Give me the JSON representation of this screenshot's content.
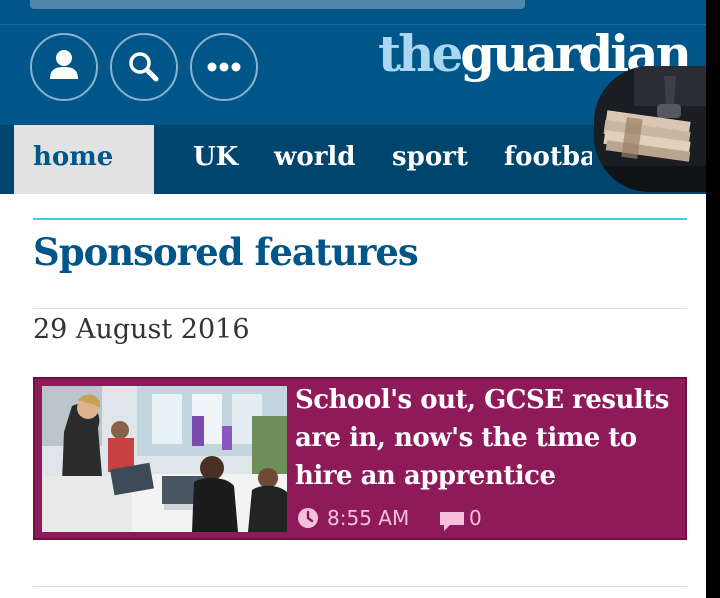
{
  "header": {
    "logo_the": "the",
    "logo_guardian": "guardian",
    "buttons": [
      {
        "name": "profile",
        "icon": "profile-icon"
      },
      {
        "name": "search",
        "icon": "search-icon"
      },
      {
        "name": "more",
        "icon": "more-icon"
      }
    ],
    "colors": {
      "background": "#005689",
      "logo_the": "#a9d7f2",
      "logo_guardian": "#ffffff"
    }
  },
  "nav": {
    "items": [
      "home",
      "UK",
      "world",
      "sport",
      "footba"
    ],
    "active": "home",
    "colors": {
      "background": "#00456e",
      "active_background": "#e2e2e2",
      "active_text": "#005689"
    }
  },
  "section": {
    "title": "Sponsored features",
    "date": "29 August 2016"
  },
  "card": {
    "title_lines": [
      "School's out, GCSE results",
      "are in, now's the time to",
      "hire an apprentice"
    ],
    "time": "8:55 AM",
    "comments": "0",
    "colors": {
      "background": "#8f1a5a",
      "meta": "#f6c0dc"
    }
  }
}
